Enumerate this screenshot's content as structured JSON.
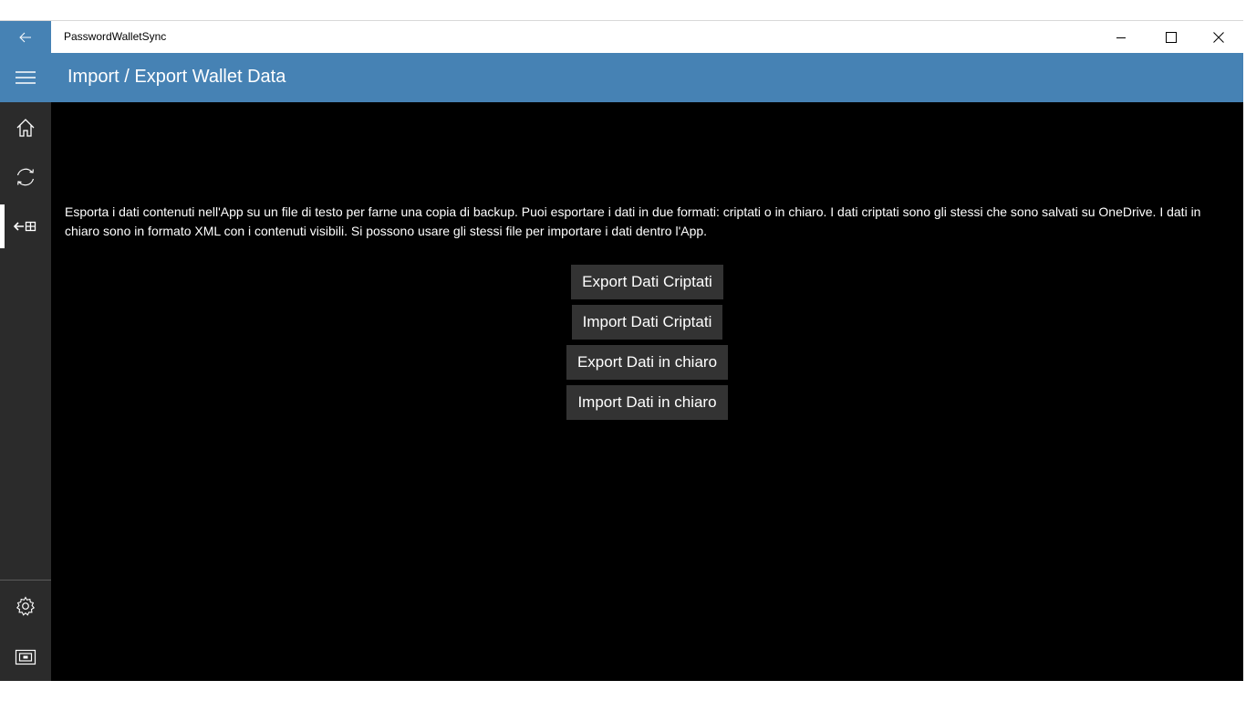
{
  "window": {
    "app_title": "PasswordWalletSync",
    "accent_color": "#4682b4"
  },
  "header": {
    "title": "Import / Export Wallet Data"
  },
  "sidebar": {
    "items": [
      {
        "icon": "home-icon"
      },
      {
        "icon": "sync-icon"
      },
      {
        "icon": "import-export-icon",
        "selected": true
      }
    ],
    "bottom_items": [
      {
        "icon": "gear-icon"
      },
      {
        "icon": "screen-icon"
      }
    ]
  },
  "main": {
    "description": "Esporta i dati contenuti nell'App su un file di testo per farne una copia di backup. Puoi esportare i dati in due formati: criptati o in chiaro. I dati criptati sono gli stessi che sono salvati su OneDrive. I dati in chiaro sono in formato XML con i contenuti visibili. Si possono usare gli stessi file per importare i dati dentro l'App.",
    "buttons": {
      "export_encrypted": "Export Dati Criptati",
      "import_encrypted": "Import Dati Criptati",
      "export_plain": "Export Dati in chiaro",
      "import_plain": "Import Dati in chiaro"
    }
  }
}
